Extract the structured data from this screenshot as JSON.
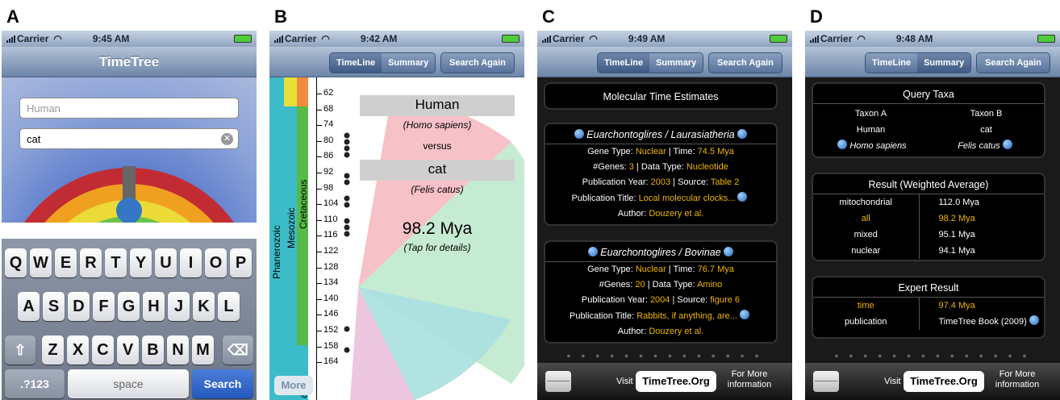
{
  "panels": {
    "a": {
      "label": "A",
      "status": {
        "carrier": "Carrier",
        "time": "9:45 AM"
      },
      "title": "TimeTree",
      "field1": {
        "placeholder": "Human"
      },
      "field2": {
        "value": "cat"
      },
      "rows": [
        [
          "Q",
          "W",
          "E",
          "R",
          "T",
          "Y",
          "U",
          "I",
          "O",
          "P"
        ],
        [
          "A",
          "S",
          "D",
          "F",
          "G",
          "H",
          "J",
          "K",
          "L"
        ],
        [
          "Z",
          "X",
          "C",
          "V",
          "B",
          "N",
          "M"
        ]
      ],
      "k123": ".?123",
      "kspace": "space",
      "ksearch": "Search"
    },
    "b": {
      "label": "B",
      "status": {
        "carrier": "Carrier",
        "time": "9:42 AM"
      },
      "seg": [
        "TimeLine",
        "Summary"
      ],
      "search_again": "Search Again",
      "ticks": [
        "62",
        "68",
        "74",
        "80",
        "86",
        "92",
        "98",
        "104",
        "110",
        "116",
        "122",
        "128",
        "134",
        "140",
        "146",
        "152",
        "158",
        "164"
      ],
      "eras": {
        "phanerozoic": "Phanerozoic",
        "mesozoic": "Mesozoic",
        "cretaceous": "Cretaceous",
        "jurassic": "assic"
      },
      "taxon_a": "Human",
      "taxon_a_sci": "(Homo sapiens)",
      "versus": "versus",
      "taxon_b": "cat",
      "taxon_b_sci": "(Felis catus)",
      "estimate": "98.2 Mya",
      "tap": "(Tap for details)",
      "more": "More"
    },
    "c": {
      "label": "C",
      "status": {
        "carrier": "Carrier",
        "time": "9:49 AM"
      },
      "seg": [
        "TimeLine",
        "Summary"
      ],
      "search_again": "Search Again",
      "header": "Molecular Time Estimates",
      "cards": [
        {
          "title": "Euarchontoglires / Laurasiatheria",
          "l1a": "Gene Type: ",
          "l1b": "Nuclear",
          "l1c": " | Time: ",
          "l1d": "74.5 Mya",
          "l2a": "#Genes: ",
          "l2b": "3",
          "l2c": " | Data Type: ",
          "l2d": "Nucleotide",
          "l3a": "Publication Year: ",
          "l3b": "2003",
          "l3c": " | Source: ",
          "l3d": "Table 2",
          "l4a": "Publication Title: ",
          "l4b": "Local molecular clocks...",
          "l5a": "Author: ",
          "l5b": "Douzery et al."
        },
        {
          "title": "Euarchontoglires / Bovinae",
          "l1a": "Gene Type: ",
          "l1b": "Nuclear",
          "l1c": " | Time: ",
          "l1d": "76.7 Mya",
          "l2a": "#Genes: ",
          "l2b": "20",
          "l2c": " | Data Type: ",
          "l2d": "Amino",
          "l3a": "Publication Year: ",
          "l3b": "2004",
          "l3c": " | Source: ",
          "l3d": "figure 6",
          "l4a": "Publication Title: ",
          "l4b": "Rabbits, if anything, are...",
          "l5a": "Author: ",
          "l5b": "Douzery et al."
        }
      ],
      "dots": "● ● ● ● ● ● ● ● ● ● ● ● ● ●",
      "visit": "Visit",
      "site": "TimeTree.Org",
      "formore": "For More information"
    },
    "d": {
      "label": "D",
      "status": {
        "carrier": "Carrier",
        "time": "9:48 AM"
      },
      "seg": [
        "TimeLine",
        "Summary"
      ],
      "search_again": "Search Again",
      "query_title": "Query Taxa",
      "taxon_a_h": "Taxon A",
      "taxon_b_h": "Taxon B",
      "taxon_a": "Human",
      "taxon_b": "cat",
      "taxon_a_sci": "Homo sapiens",
      "taxon_b_sci": "Felis catus",
      "result_title": "Result (Weighted Average)",
      "results": [
        {
          "k": "mitochondrial",
          "v": "112.0 Mya"
        },
        {
          "k": "all",
          "v": "98.2 Mya"
        },
        {
          "k": "mixed",
          "v": "95.1 Mya"
        },
        {
          "k": "nuclear",
          "v": "94.1 Mya"
        }
      ],
      "expert_title": "Expert Result",
      "expert": [
        {
          "k": "time",
          "v": "97.4 Mya"
        },
        {
          "k": "publication",
          "v": "TimeTree Book (2009)"
        }
      ],
      "visit": "Visit",
      "site": "TimeTree.Org",
      "formore": "For More information"
    }
  }
}
